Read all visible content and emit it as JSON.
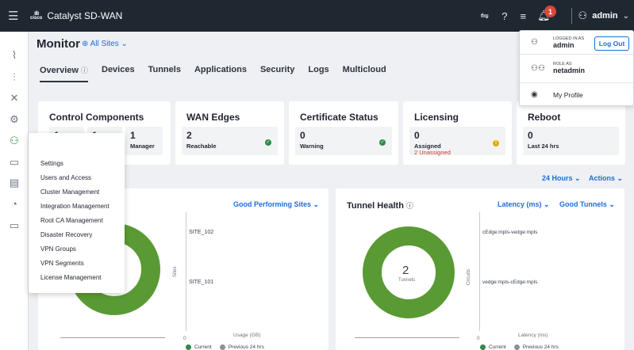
{
  "app": {
    "title": "Catalyst SD-WAN",
    "logo_text": "cisco"
  },
  "topbar": {
    "username": "admin",
    "notification_count": "1"
  },
  "header": {
    "title": "Monitor",
    "site_filter": "All Sites"
  },
  "tabs": [
    {
      "label": "Overview",
      "active": true
    },
    {
      "label": "Devices"
    },
    {
      "label": "Tunnels"
    },
    {
      "label": "Applications"
    },
    {
      "label": "Security"
    },
    {
      "label": "Logs"
    },
    {
      "label": "Multicloud"
    }
  ],
  "cards": {
    "control": {
      "title": "Control Components",
      "manager_count": "1",
      "manager_label": "Manager",
      "c1": "1",
      "c2": "1"
    },
    "wan": {
      "title": "WAN Edges",
      "count": "2",
      "label": "Reachable"
    },
    "cert": {
      "title": "Certificate Status",
      "count": "0",
      "label": "Warning"
    },
    "licensing": {
      "title": "Licensing",
      "count": "0",
      "label": "Assigned",
      "sub": "2 Unassigned"
    },
    "reboot": {
      "title": "Reboot",
      "count": "0",
      "label": "Last 24 hrs"
    }
  },
  "filters": {
    "time": "24 Hours",
    "actions": "Actions"
  },
  "site_panel": {
    "dropdown": "Good Performing Sites",
    "sites": [
      "SITE_102",
      "SITE_101"
    ],
    "y_axis": "Sites",
    "x_axis": "Usage (GB)",
    "x_zero": "0",
    "legend": [
      "Current",
      "Previous 24 hrs"
    ]
  },
  "tunnel_panel": {
    "title": "Tunnel Health",
    "latency_dropdown": "Latency (ms)",
    "filter_dropdown": "Good Tunnels",
    "donut_value": "2",
    "donut_label": "Tunnels",
    "tunnels": [
      "cEdge:mpls-vedge:mpls",
      "vedge:mpls-cEdge:mpls"
    ],
    "y_axis": "Circuits",
    "x_axis": "Latency (ms)",
    "x_zero": "0",
    "legend": [
      "Current",
      "Previous 24 hrs"
    ]
  },
  "user_menu": {
    "logged_in_caption": "LOGGED IN AS",
    "logged_in_value": "admin",
    "logout_label": "Log Out",
    "role_caption": "ROLE AS",
    "role_value": "netadmin",
    "profile_label": "My Profile"
  },
  "settings_menu": [
    "Settings",
    "Users and Access",
    "Cluster Management",
    "Integration Management",
    "Root CA Management",
    "Disaster Recovery",
    "VPN Groups",
    "VPN Segments",
    "License Management"
  ],
  "colors": {
    "topbar": "#1f2730",
    "accent": "#1d6ed8",
    "donut": "#5a9a34",
    "ok": "#2f8b48",
    "warn": "#e8a800",
    "alert": "#d8493a"
  }
}
